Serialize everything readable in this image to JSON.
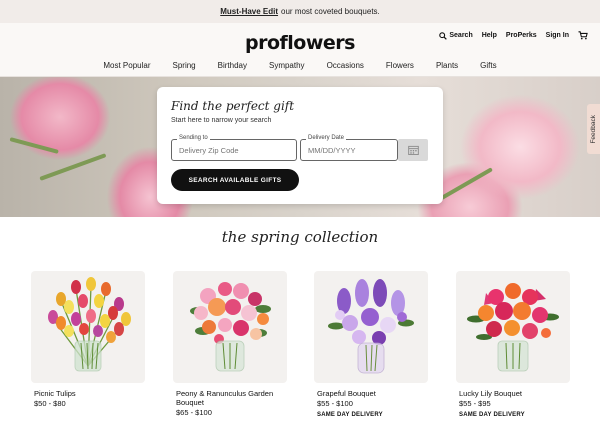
{
  "promo": {
    "link": "Must-Have Edit",
    "text": "our most coveted bouquets."
  },
  "header": {
    "logo": "proflowers",
    "utility": {
      "search": "Search",
      "help": "Help",
      "properks": "ProPerks",
      "signin": "Sign In",
      "cart_icon": "cart-icon"
    }
  },
  "nav": [
    "Most Popular",
    "Spring",
    "Birthday",
    "Sympathy",
    "Occasions",
    "Flowers",
    "Plants",
    "Gifts"
  ],
  "finder": {
    "title": "Find the perfect gift",
    "subtitle": "Start here to narrow your search",
    "zip": {
      "label": "Sending to",
      "placeholder": "Delivery Zip Code"
    },
    "date": {
      "label": "Delivery Date",
      "placeholder": "MM/DD/YYYY"
    },
    "calendar_icon": "calendar-icon",
    "button": "SEARCH AVAILABLE GIFTS"
  },
  "feedback": "Feedback",
  "collection": {
    "title": "the spring collection",
    "products": [
      {
        "name": "Picnic Tulips",
        "price": "$50 - $80",
        "badge": ""
      },
      {
        "name": "Peony & Ranunculus Garden Bouquet",
        "price": "$65 - $100",
        "badge": ""
      },
      {
        "name": "Grapeful Bouquet",
        "price": "$55 - $100",
        "badge": "SAME DAY DELIVERY"
      },
      {
        "name": "Lucky Lily Bouquet",
        "price": "$55 - $95",
        "badge": "SAME DAY DELIVERY"
      }
    ]
  },
  "colors": {
    "promo_bg": "#f1ece9",
    "header_bg": "#faf8f6",
    "button_bg": "#111111",
    "card_bg": "#f3f1ef"
  }
}
